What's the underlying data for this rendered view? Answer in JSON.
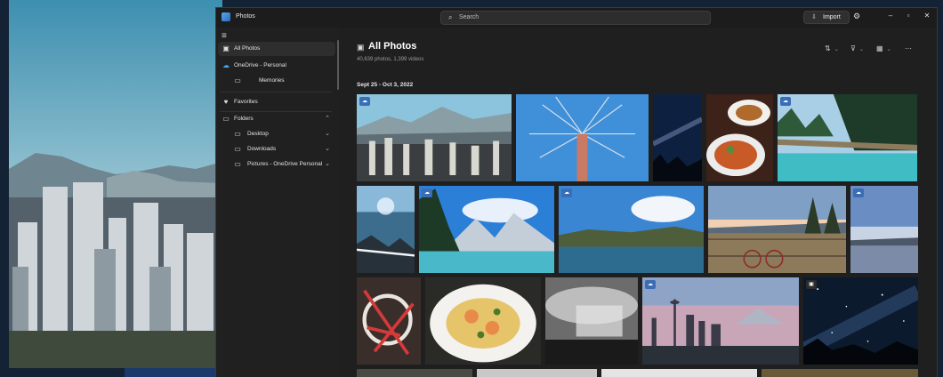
{
  "window": {
    "app_title": "Photos",
    "search_placeholder": "Search",
    "import_label": "Import",
    "controls": [
      "minimize-icon",
      "maximize-icon",
      "close-icon"
    ]
  },
  "sidebar": {
    "items": [
      {
        "label": "All Photos",
        "icon": "photos-icon",
        "active": true
      },
      {
        "label": "OneDrive - Personal",
        "icon": "cloud-icon"
      },
      {
        "label": "Memories",
        "icon": "memories-icon"
      },
      {
        "label": "Favorites",
        "icon": "heart-icon"
      },
      {
        "label": "Folders",
        "icon": "folder-icon",
        "expanded": true
      },
      {
        "label": "Desktop",
        "icon": "folder-icon"
      },
      {
        "label": "Downloads",
        "icon": "folder-icon"
      },
      {
        "label": "Pictures - OneDrive Personal",
        "icon": "folder-icon"
      }
    ]
  },
  "main": {
    "title": "All Photos",
    "subtitle": "40,639 photos, 1,399 videos",
    "date_group": "Sept 25 - Oct 3, 2022",
    "toolbar": [
      "sort-icon",
      "filter-icon",
      "view-icon",
      "more-icon"
    ]
  },
  "colors": {
    "window_bg": "#202020",
    "accent": "#3a6db5",
    "text": "#ffffff",
    "muted": "#9a9a9a"
  },
  "photos": [
    {
      "name": "city-mountains",
      "badge": "cloud"
    },
    {
      "name": "swing-ride-tower",
      "badge": ""
    },
    {
      "name": "night-sky-trees",
      "badge": ""
    },
    {
      "name": "food-bowls",
      "badge": ""
    },
    {
      "name": "bridge-forest",
      "badge": "cloud"
    },
    {
      "name": "beach-rocks",
      "badge": ""
    },
    {
      "name": "lake-mountains",
      "badge": "cloud"
    },
    {
      "name": "sea-hills",
      "badge": "cloud"
    },
    {
      "name": "bike-fence",
      "badge": ""
    },
    {
      "name": "harbor-dusk",
      "badge": "cloud"
    },
    {
      "name": "red-chair",
      "badge": ""
    },
    {
      "name": "pasta-plate",
      "badge": ""
    },
    {
      "name": "storm-clouds",
      "badge": ""
    },
    {
      "name": "seattle-skyline",
      "badge": "cloud"
    },
    {
      "name": "milky-way",
      "badge": "dark"
    }
  ]
}
